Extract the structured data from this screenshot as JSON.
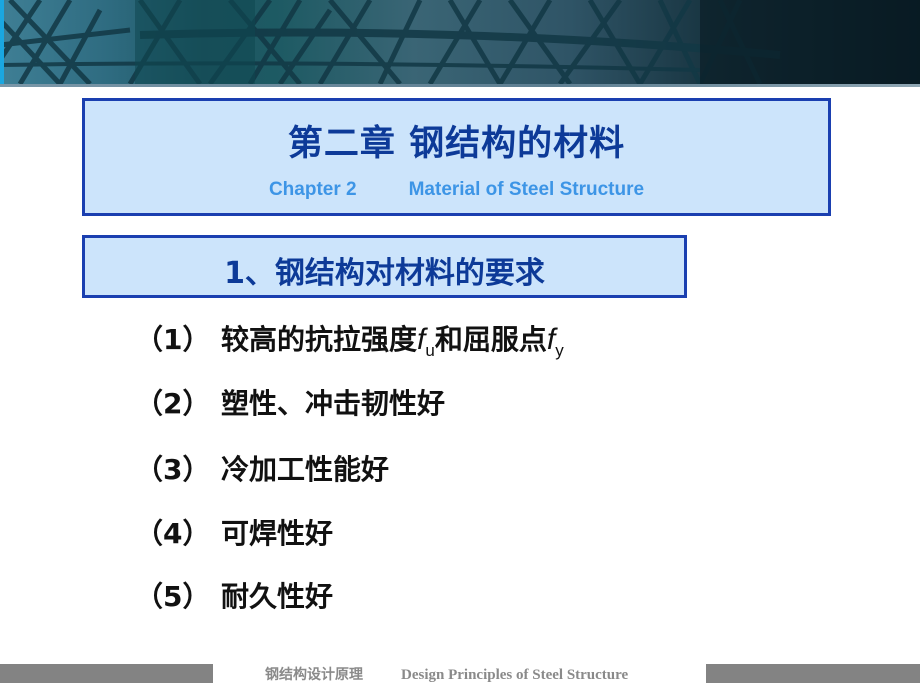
{
  "slide": {
    "banner": {
      "image_description": "steel space-frame dome structure photo"
    },
    "title": {
      "chinese": "第二章  钢结构的材料",
      "chapter": "Chapter 2",
      "english": "Material of Steel Structure"
    },
    "section": {
      "heading": "1、钢结构对材料的要求"
    },
    "requirements": [
      {
        "number": "（1）",
        "text": "较高的抗拉强度",
        "symbol1": "f",
        "sub1": "u",
        "middle": "和屈服点",
        "symbol2": "f",
        "sub2": "y"
      },
      {
        "number": "（2）",
        "text": "塑性、冲击韧性好"
      },
      {
        "number": "（3）",
        "text": "冷加工性能好"
      },
      {
        "number": "（4）",
        "text": "可焊性好"
      },
      {
        "number": "（5）",
        "text": "耐久性好"
      }
    ],
    "footer": {
      "course_cn": "钢结构设计原理",
      "course_en": "Design Principles of Steel Structure"
    }
  },
  "colors": {
    "box_fill": "#cce4fb",
    "box_border": "#1a3fb0",
    "heading_text": "#0d3a98",
    "subtitle_text": "#3d95e6",
    "footer_gray": "#838383"
  }
}
